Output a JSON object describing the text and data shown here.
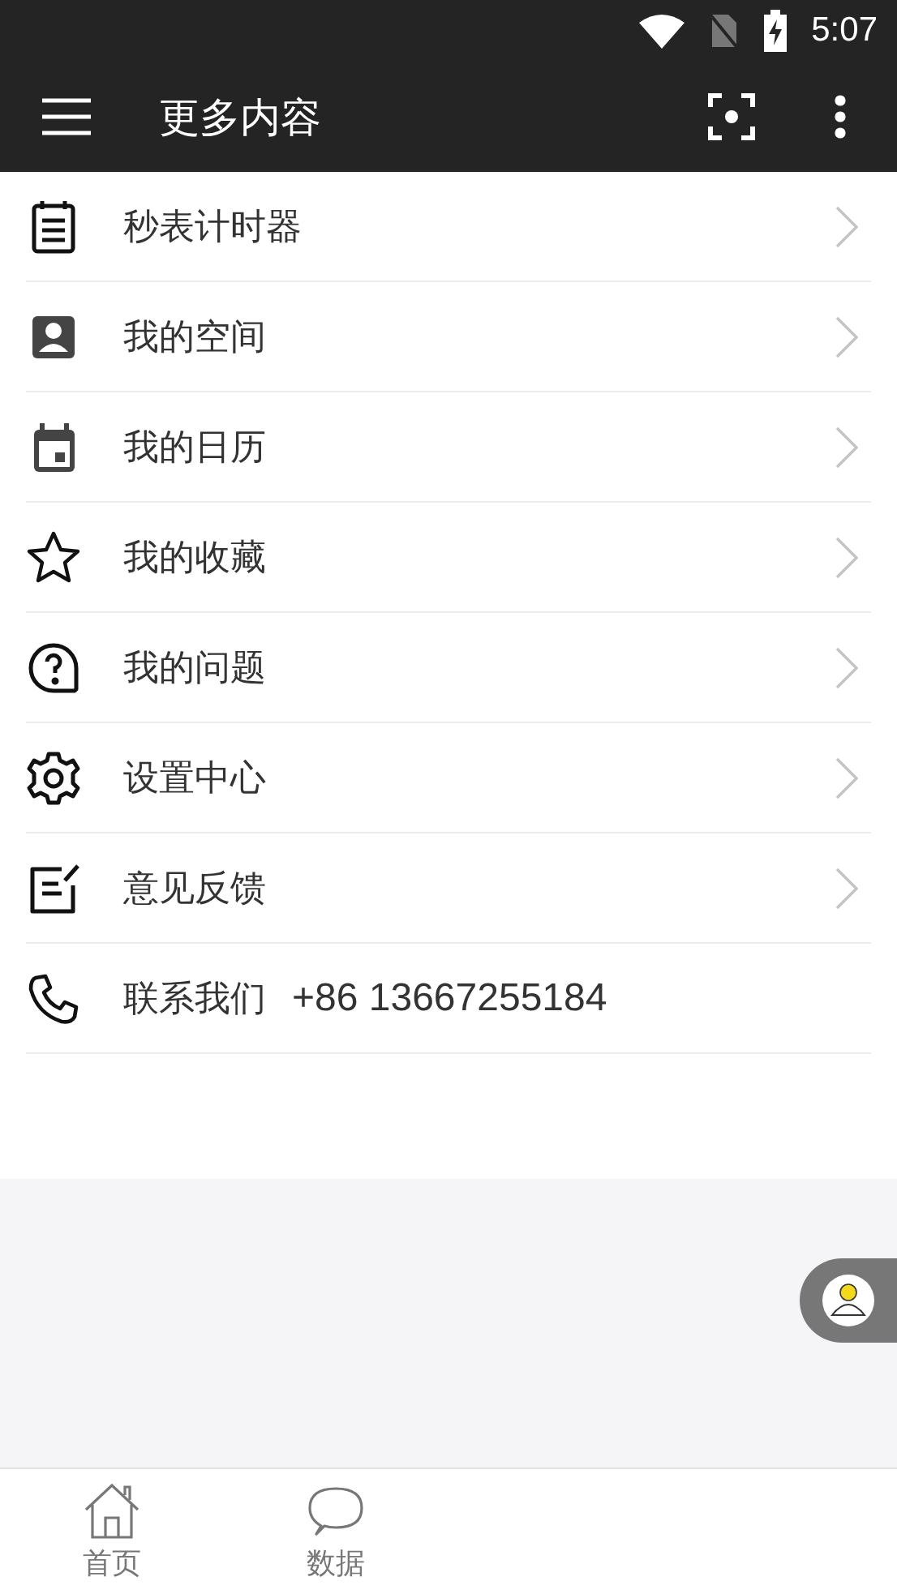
{
  "status_bar": {
    "time": "5:07"
  },
  "toolbar": {
    "title": "更多内容"
  },
  "items": [
    {
      "kind": "link",
      "label": "秒表计时器"
    },
    {
      "kind": "link",
      "label": "我的空间"
    },
    {
      "kind": "link",
      "label": "我的日历"
    },
    {
      "kind": "link",
      "label": "我的收藏"
    },
    {
      "kind": "link",
      "label": "我的问题"
    },
    {
      "kind": "link",
      "label": "设置中心"
    },
    {
      "kind": "link",
      "label": "意见反馈"
    },
    {
      "kind": "contact",
      "label": "联系我们",
      "phone": "+86 13667255184"
    }
  ],
  "bottom_nav": [
    {
      "label": "首页"
    },
    {
      "label": "数据"
    }
  ]
}
